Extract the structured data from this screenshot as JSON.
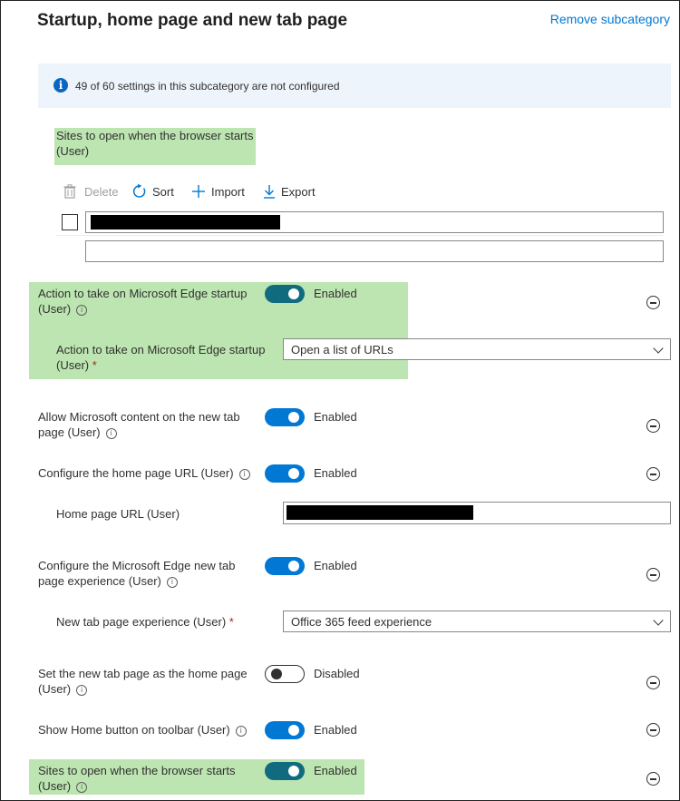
{
  "header": {
    "title": "Startup, home page and new tab page",
    "remove_link": "Remove subcategory"
  },
  "info_bar": {
    "icon": "info-icon",
    "text": "49 of 60 settings in this subcategory are not configured"
  },
  "sites_list": {
    "label_line1": "Sites to open when the browser starts",
    "label_line2": "(User)",
    "toolbar": {
      "delete": "Delete",
      "sort": "Sort",
      "import": "Import",
      "export": "Export"
    },
    "rows": [
      {
        "value_redacted": true
      },
      {
        "value": ""
      }
    ]
  },
  "settings": {
    "startup_action": {
      "label_line1": "Action to take on Microsoft Edge startup",
      "label_line2": "(User)",
      "state": "Enabled",
      "sub_label_line1": "Action to take on Microsoft Edge startup",
      "sub_label_line2": "(User)",
      "required_mark": "*",
      "dropdown_value": "Open a list of URLs"
    },
    "ms_content": {
      "label_line1": "Allow Microsoft content on the new tab",
      "label_line2": "page (User)",
      "state": "Enabled"
    },
    "home_url": {
      "label": "Configure the home page URL (User)",
      "state": "Enabled",
      "sub_label": "Home page URL (User)",
      "value_redacted": true
    },
    "new_tab_experience": {
      "label_line1": "Configure the Microsoft Edge new tab",
      "label_line2": "page experience (User)",
      "state": "Enabled",
      "sub_label": "New tab page experience (User)",
      "required_mark": "*",
      "dropdown_value": "Office 365 feed experience"
    },
    "new_tab_as_home": {
      "label_line1": "Set the new tab page as the home page",
      "label_line2": "(User)",
      "state": "Disabled"
    },
    "home_button": {
      "label": "Show Home button on toolbar (User)",
      "state": "Enabled"
    },
    "sites_on_start": {
      "label_line1": "Sites to open when the browser starts",
      "label_line2": "(User)",
      "state": "Enabled"
    }
  },
  "colors": {
    "accent": "#0078d4",
    "highlight": "#bce5b1",
    "info_bg": "#eef4fb",
    "toggle_dark": "#106b7e"
  }
}
